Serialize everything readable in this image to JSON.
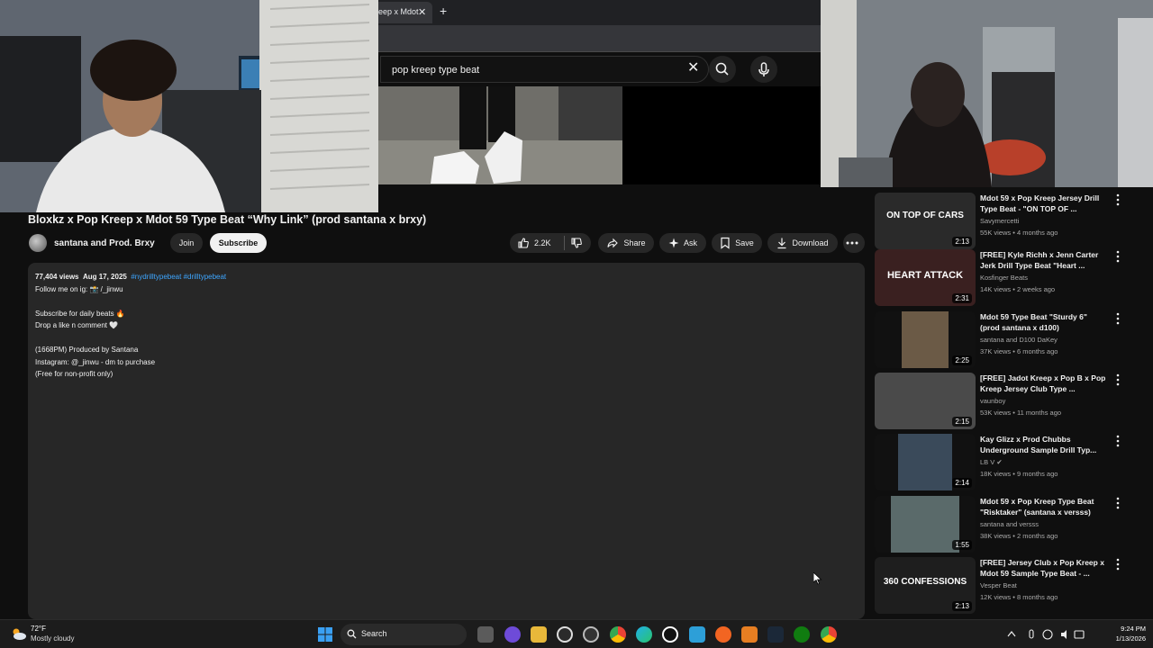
{
  "browser": {
    "tab_label": "eep x Mdot",
    "tab_close_label": "✕",
    "new_tab_label": "+"
  },
  "search": {
    "query": "pop kreep type beat",
    "clear_label": "✕"
  },
  "video": {
    "title": "Bloxkz x Pop Kreep x Mdot 59 Type Beat “Why Link” (prod santana x brxy)",
    "channel_name": "santana and Prod. Brxy",
    "join_label": "Join",
    "subscribe_label": "Subscribe",
    "like_count": "2.2K",
    "share_label": "Share",
    "ask_label": "Ask",
    "save_label": "Save",
    "download_label": "Download"
  },
  "description": {
    "views": "77,404 views",
    "date": "Aug 17, 2025",
    "hashtags": "#nydrilltypebeat #drilltypebeat",
    "follow_line": "Follow me on ig: 📸 /_jinwu",
    "line_subscribe": "Subscribe for daily beats 🔥",
    "line_like": "Drop a like n comment 🤍",
    "line_produced": "(1668PM) Produced by Santana",
    "line_instagram": "Instagram: @_jinwu - dm to purchase",
    "line_free": "(Free for non-profit only)"
  },
  "recommendations": [
    {
      "title": "Mdot 59 x Pop Kreep Jersey Drill Type Beat - \"ON TOP OF ...",
      "channel": "Savymercetti",
      "views": "55K views • 4 months ago",
      "duration": "2:13",
      "thumb_text": "ON TOP OF CARS",
      "thumb_color": "#2a2a2a"
    },
    {
      "title": "[FREE] Kyle Richh x Jenn Carter Jerk Drill Type Beat \"Heart ...",
      "channel": "Kosfinger Beats",
      "views": "14K views • 2 weeks ago",
      "duration": "2:31",
      "thumb_text": "HEART ATTACK",
      "thumb_color": "#3a2020"
    },
    {
      "title": "Mdot 59 Type Beat \"Sturdy 6\" (prod santana x d100)",
      "channel": "santana and D100 DaKey",
      "views": "37K views • 6 months ago",
      "duration": "2:25",
      "thumb_text": "",
      "thumb_color": "#6b5a46"
    },
    {
      "title": "[FREE] Jadot Kreep x Pop B x Pop Kreep Jersey Club Type ...",
      "channel": "vaunboy",
      "views": "53K views • 11 months ago",
      "duration": "2:15",
      "thumb_text": "",
      "thumb_color": "#4a4a4a"
    },
    {
      "title": "Kay Glizz x Prod Chubbs Underground Sample Drill Typ...",
      "channel": "LB V",
      "views": "18K views • 9 months ago",
      "duration": "2:14",
      "thumb_text": "",
      "thumb_color": "#3a4a5a"
    },
    {
      "title": "Mdot 59 x Pop Kreep Type Beat \"Risktaker\" (santana x versss)",
      "channel": "santana and versss",
      "views": "38K views • 2 months ago",
      "duration": "1:55",
      "thumb_text": "",
      "thumb_color": "#5a6a6a"
    },
    {
      "title": "[FREE] Jersey Club x Pop Kreep x Mdot 59 Sample Type Beat - ...",
      "channel": "Vesper Beat",
      "views": "12K views • 8 months ago",
      "duration": "2:13",
      "thumb_text": "360 CONFESSIONS",
      "thumb_color": "#1e1e1e"
    }
  ],
  "taskbar": {
    "temperature": "72°F",
    "weather": "Mostly cloudy",
    "search_label": "Search",
    "time": "9:24 PM",
    "date": "1/13/2026"
  },
  "colors": {
    "background": "#0f0f0f",
    "surface": "#272727",
    "link": "#3ea6ff",
    "subscribe_bg": "#f1f1f1"
  }
}
